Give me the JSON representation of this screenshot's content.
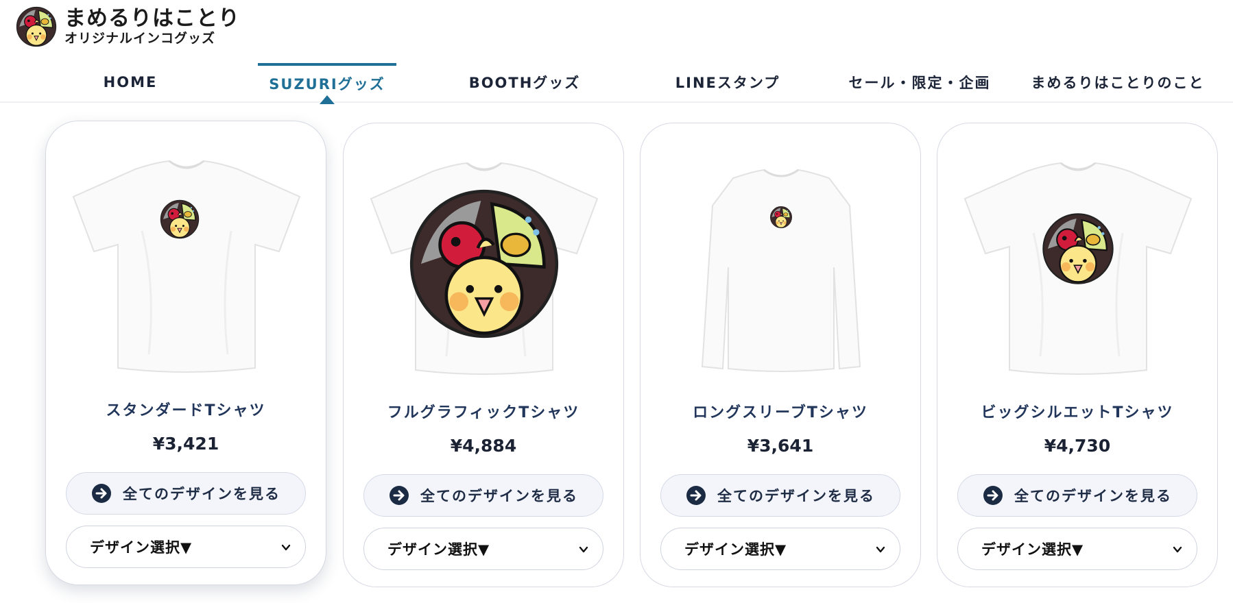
{
  "brand": {
    "title": "まめるりはことり",
    "subtitle": "オリジナルインコグッズ"
  },
  "nav": {
    "items": [
      {
        "label": "HOME",
        "active": false
      },
      {
        "label": "SUZURIグッズ",
        "active": true
      },
      {
        "label": "BOOTHグッズ",
        "active": false
      },
      {
        "label": "LINEスタンプ",
        "active": false
      },
      {
        "label": "セール・限定・企画",
        "active": false
      },
      {
        "label": "まめるりはことりのこと",
        "active": false
      }
    ]
  },
  "colors": {
    "accent": "#1f6f96",
    "navy": "#1c2b44",
    "button_bg": "#f3f5fa"
  },
  "products": [
    {
      "name": "スタンダードTシャツ",
      "price": "¥3,421",
      "view_label": "全てのデザインを見る",
      "select_label": "デザイン選択▼",
      "icon": "tshirt-icon"
    },
    {
      "name": "フルグラフィックTシャツ",
      "price": "¥4,884",
      "view_label": "全てのデザインを見る",
      "select_label": "デザイン選択▼",
      "icon": "tshirt-icon"
    },
    {
      "name": "ロングスリーブTシャツ",
      "price": "¥3,641",
      "view_label": "全てのデザインを見る",
      "select_label": "デザイン選択▼",
      "icon": "longsleeve-icon"
    },
    {
      "name": "ビッグシルエットTシャツ",
      "price": "¥4,730",
      "view_label": "全てのデザインを見る",
      "select_label": "デザイン選択▼",
      "icon": "tshirt-icon"
    }
  ]
}
